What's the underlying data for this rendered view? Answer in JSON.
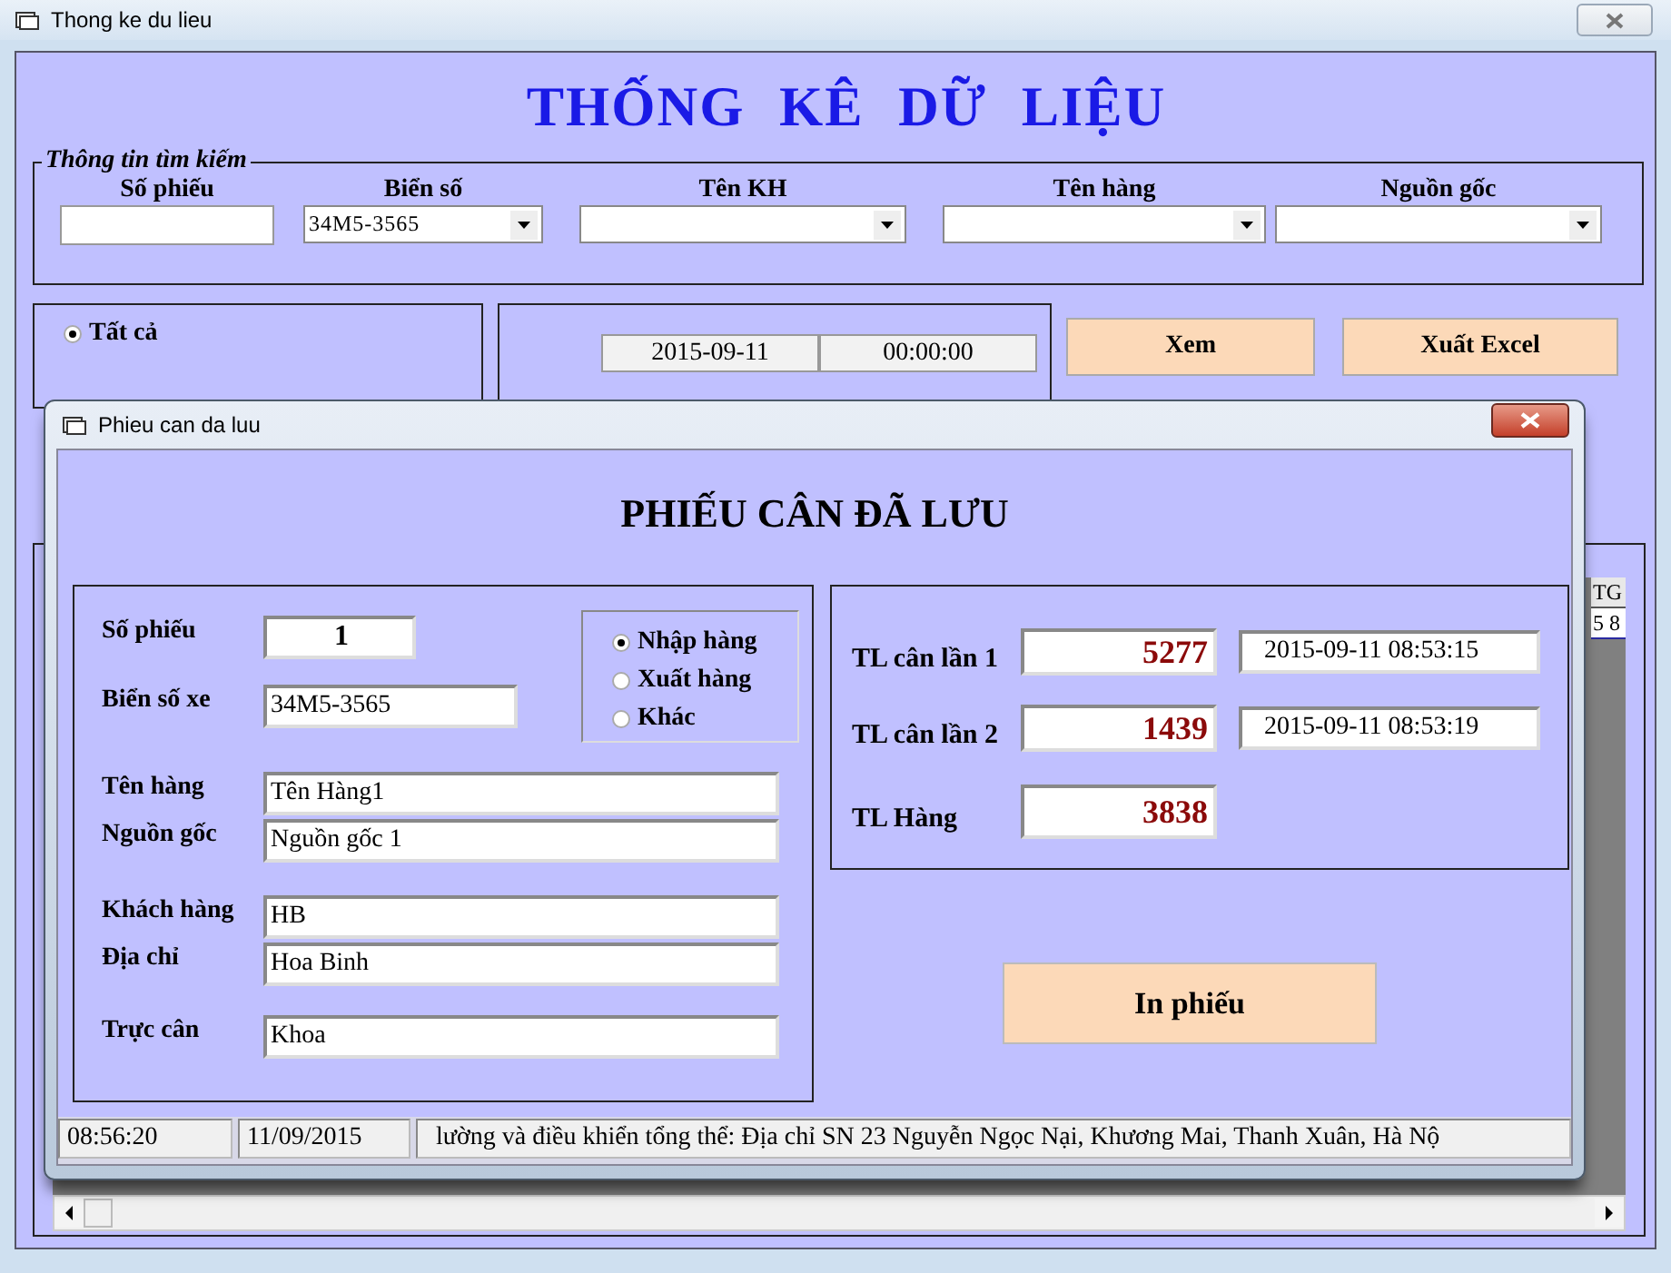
{
  "window": {
    "title": "Thong ke du lieu"
  },
  "heading": "THỐNG KÊ DỮ LIỆU",
  "search": {
    "legend": "Thông tin tìm kiếm",
    "fields": [
      {
        "label": "Số phiếu",
        "kind": "text"
      },
      {
        "label": "Biển số",
        "kind": "combo",
        "value": "34M5-3565"
      },
      {
        "label": "Tên KH",
        "kind": "combo"
      },
      {
        "label": "Tên hàng",
        "kind": "combo"
      },
      {
        "label": "Nguồn gốc",
        "kind": "combo"
      }
    ]
  },
  "filter": {
    "options": [
      {
        "label": "Tất cả",
        "selected": true
      }
    ]
  },
  "date_range": {
    "fields": [
      "2015-09-11",
      "00:00:00"
    ]
  },
  "buttons": [
    "Xem",
    "Xuất Excel"
  ],
  "grid": {
    "columns": [
      "TG"
    ],
    "rows": [
      [
        "5 8"
      ]
    ]
  },
  "dialog": {
    "title": "Phieu can da luu",
    "heading": "PHIẾU CÂN ĐÃ LƯU",
    "fields": [
      {
        "label": "Số phiếu",
        "value": "1",
        "kind": "number"
      },
      {
        "label": "Biển số xe",
        "value": "34M5-3565",
        "kind": "short"
      },
      {
        "label": "Tên hàng",
        "value": "Tên Hàng1",
        "kind": "wide"
      },
      {
        "label": "Nguồn gốc",
        "value": "Nguồn gốc 1",
        "kind": "wide"
      },
      {
        "label": "Khách hàng",
        "value": "HB",
        "kind": "wide"
      },
      {
        "label": "Địa chỉ",
        "value": "Hoa Binh",
        "kind": "wide"
      },
      {
        "label": "Trực cân",
        "value": "Khoa",
        "kind": "wide"
      }
    ],
    "types": [
      {
        "label": "Nhập hàng",
        "selected": true
      },
      {
        "label": "Xuất hàng",
        "selected": false
      },
      {
        "label": "Khác",
        "selected": false
      }
    ],
    "weights": [
      {
        "label": "TL cân lần 1",
        "value": "5277",
        "time": "2015-09-11 08:53:15"
      },
      {
        "label": "TL cân lần 2",
        "value": "1439",
        "time": "2015-09-11 08:53:19"
      },
      {
        "label": "TL Hàng",
        "value": "3838"
      }
    ],
    "print_button": "In phiếu",
    "status_bar": [
      "08:56:20",
      "11/09/2015",
      "lường và điều khiển tổng thể: Địa chỉ SN 23 Nguyễn Ngọc Nại, Khương Mai, Thanh Xuân, Hà Nộ"
    ]
  }
}
